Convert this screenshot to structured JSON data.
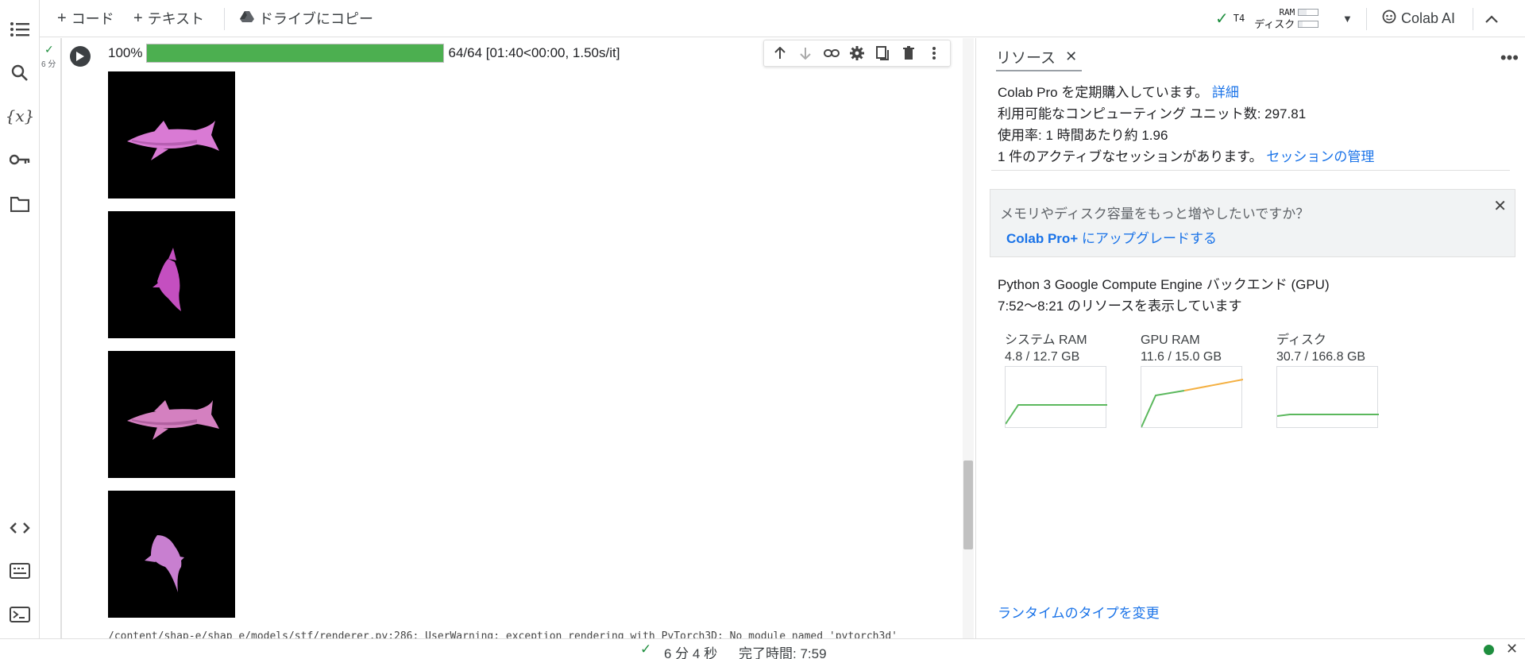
{
  "toolbar": {
    "add_code": "コード",
    "add_text": "テキスト",
    "copy_to_drive": "ドライブにコピー",
    "runtime": "T4",
    "ram_label": "RAM",
    "disk_label": "ディスク",
    "colab_ai": "Colab AI"
  },
  "cell": {
    "exec_time": "6 分",
    "progress_percent": "100%",
    "progress_fraction": 1.0,
    "progress_text": "64/64 [01:40<00:00, 1.50s/it]",
    "images": [
      {
        "name": "shark-render-1",
        "pose": "side"
      },
      {
        "name": "shark-render-2",
        "pose": "vertical"
      },
      {
        "name": "shark-render-3",
        "pose": "side"
      },
      {
        "name": "shark-render-4",
        "pose": "tilted"
      }
    ],
    "warning": "/content/shap-e/shap_e/models/stf/renderer.py:286: UserWarning: exception rendering with PyTorch3D: No module named 'pytorch3d'"
  },
  "side_panel": {
    "tab_title": "リソース",
    "pro_line": "Colab Pro を定期購入しています。",
    "pro_details_link": "詳細",
    "units_line": "利用可能なコンピューティング ユニット数: 297.81",
    "usage_line": "使用率: 1 時間あたり約 1.96",
    "session_line": "1 件のアクティブなセッションがあります。",
    "session_link": "セッションの管理",
    "upgrade_question": "メモリやディスク容量をもっと増やしたいですか？",
    "upgrade_brand": "Colab Pro+",
    "upgrade_rest": " にアップグレードする",
    "backend_line": "Python 3 Google Compute Engine バックエンド (GPU)",
    "range_line": "7:52～8:21 のリソースを表示しています",
    "graphs": [
      {
        "title": "システム RAM",
        "value": "4.8 / 12.7 GB",
        "color": "#5bb85d"
      },
      {
        "title": "GPU RAM",
        "value": "11.6 / 15.0 GB",
        "color": "#5bb85d",
        "color2": "#f4b042"
      },
      {
        "title": "ディスク",
        "value": "30.7 / 166.8 GB",
        "color": "#5bb85d"
      }
    ],
    "change_runtime": "ランタイムのタイプを変更"
  },
  "status": {
    "elapsed": "6 分 4 秒",
    "completed": "完了時間: 7:59"
  },
  "colors": {
    "progress_fill": "#4caf50",
    "link": "#1a73e8",
    "status_dot": "#1e8e3e",
    "shark_pink": "#d97ad4"
  }
}
